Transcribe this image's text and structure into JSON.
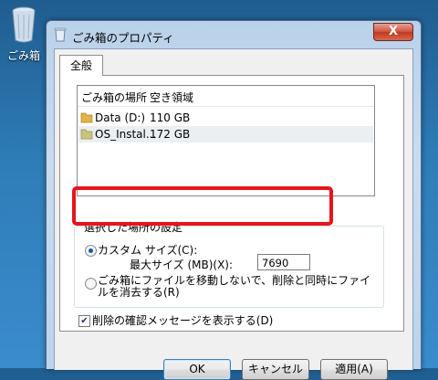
{
  "desktop": {
    "recycle_bin_label": "ごみ箱"
  },
  "window": {
    "title": "ごみ箱のプロパティ",
    "close_glyph": "X"
  },
  "tabs": [
    {
      "label": "全般"
    }
  ],
  "list": {
    "columns": [
      "ごみ箱の場所",
      "空き領域"
    ],
    "rows": [
      {
        "location": "Data (D:)",
        "free_space": "110 GB",
        "selected": false
      },
      {
        "location": "OS_Instal...",
        "free_space": "172 GB",
        "selected": true
      }
    ]
  },
  "settings": {
    "group_title": "選択した場所の設定",
    "custom_size_label": "カスタム サイズ(C):",
    "max_size_label": "最大サイズ (MB)(X):",
    "max_size_value": "7690",
    "delete_immediately_label": "ごみ箱にファイルを移動しないで、削除と同時にファイルを消去する(R)",
    "selected_option": "custom_size"
  },
  "confirm_checkbox": {
    "label": "削除の確認メッセージを表示する(D)",
    "checked": true,
    "mark": "✔"
  },
  "buttons": {
    "ok": "OK",
    "cancel": "キャンセル",
    "apply": "適用(A)"
  },
  "colors": {
    "highlight_box": "#e8141b",
    "folder": "#e2b34a"
  }
}
